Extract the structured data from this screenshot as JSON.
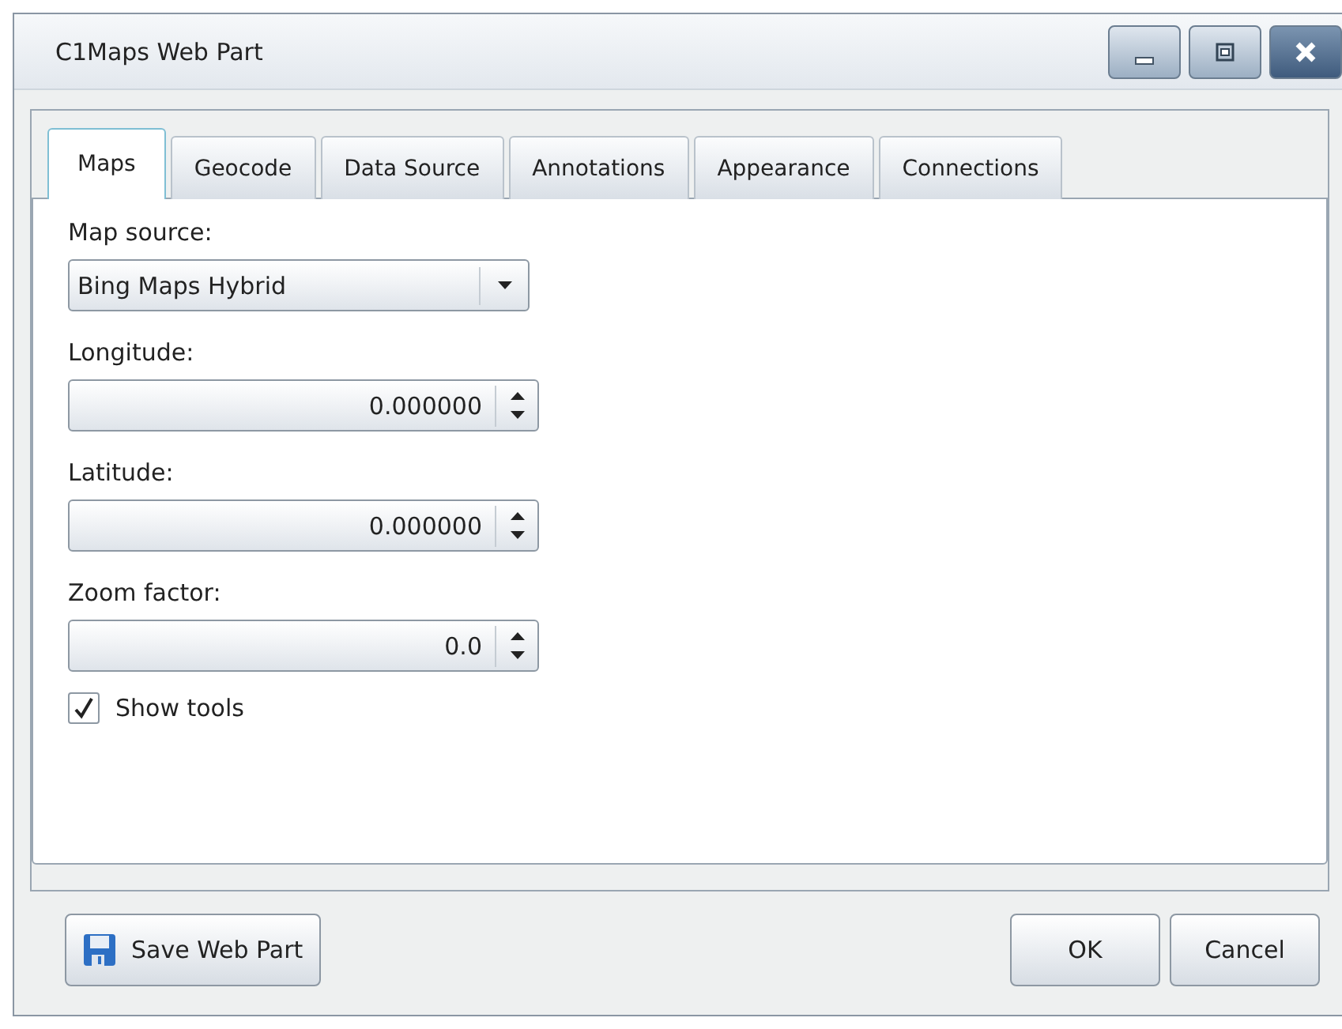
{
  "window": {
    "title": "C1Maps Web Part"
  },
  "tabs": [
    {
      "label": "Maps",
      "selected": true
    },
    {
      "label": "Geocode",
      "selected": false
    },
    {
      "label": "Data Source",
      "selected": false
    },
    {
      "label": "Annotations",
      "selected": false
    },
    {
      "label": "Appearance",
      "selected": false
    },
    {
      "label": "Connections",
      "selected": false
    }
  ],
  "fields": [
    {
      "label": "Map source:",
      "kind": "combo",
      "value": "Bing Maps Hybrid"
    },
    {
      "label": "Longitude:",
      "kind": "spin",
      "value": "0.000000"
    },
    {
      "label": "Latitude:",
      "kind": "spin",
      "value": "0.000000"
    },
    {
      "label": "Zoom factor:",
      "kind": "spin",
      "value": "0.0"
    }
  ],
  "show_tools": {
    "label": "Show tools",
    "checked": true
  },
  "buttons": {
    "save": "Save Web Part",
    "ok": "OK",
    "cancel": "Cancel"
  }
}
